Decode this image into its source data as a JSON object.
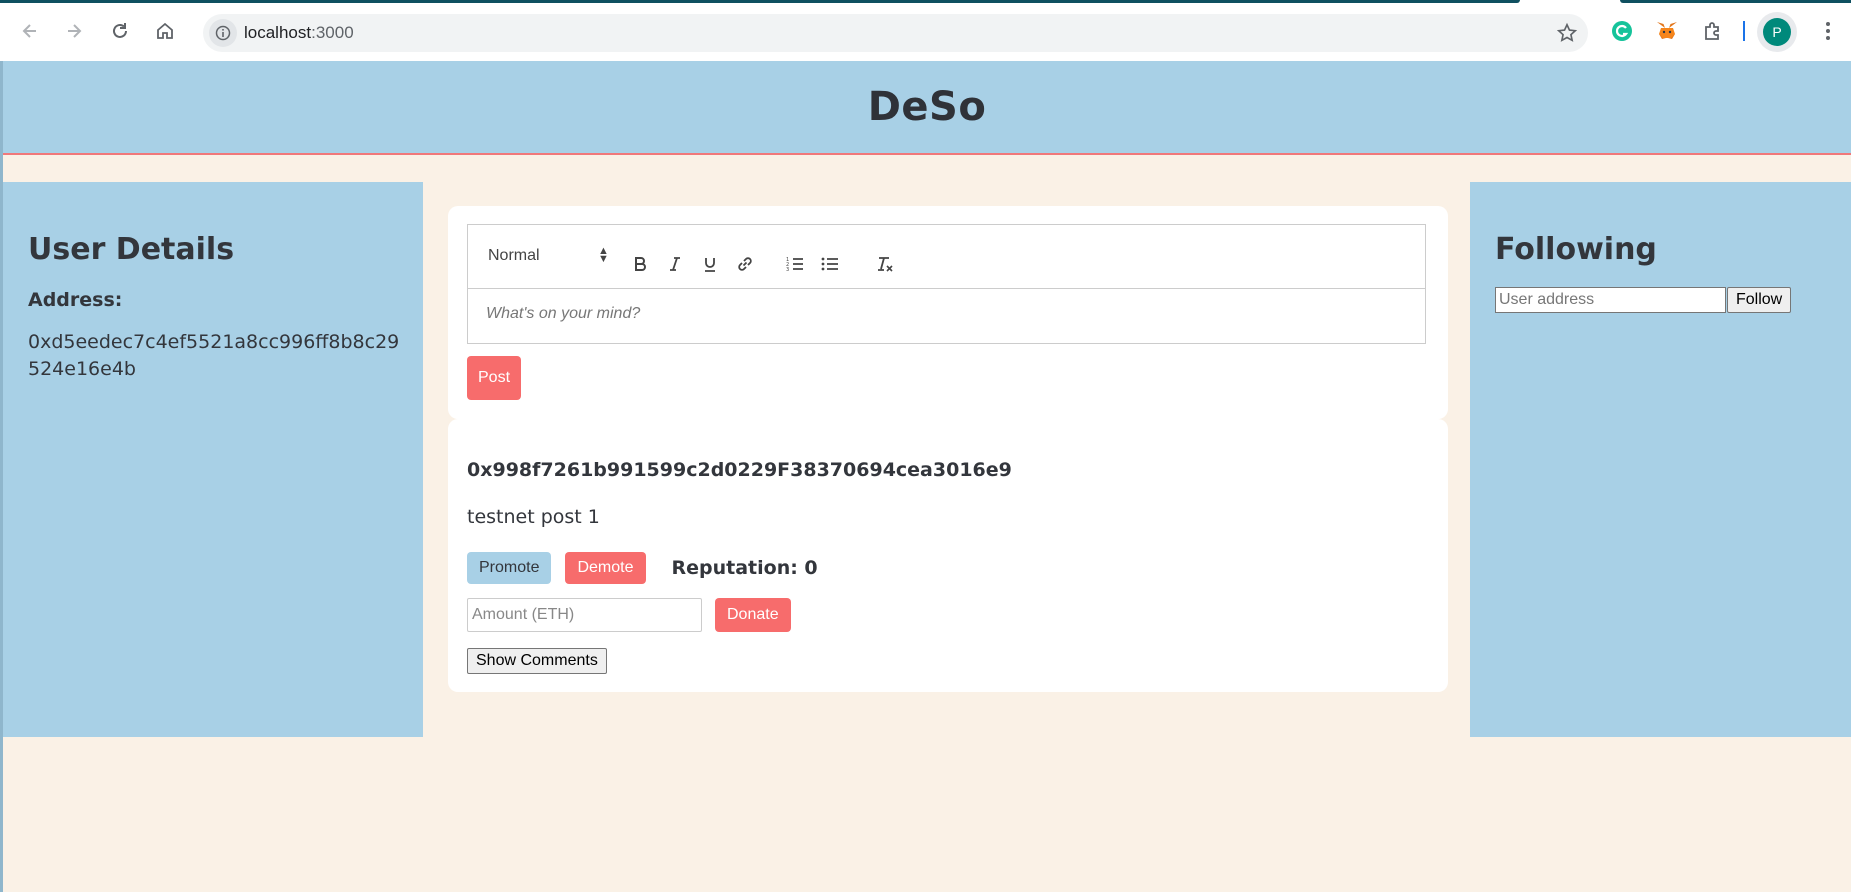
{
  "browser": {
    "url_host": "localhost",
    "url_port": ":3000",
    "profile_initial": "P"
  },
  "header": {
    "title": "DeSo"
  },
  "user_details": {
    "heading": "User Details",
    "address_label": "Address:",
    "address_value": "0xd5eedec7c4ef5521a8cc996ff8b8c29524e16e4b"
  },
  "composer": {
    "format_select": "Normal",
    "placeholder": "What's on your mind?",
    "post_label": "Post"
  },
  "post": {
    "author": "0x998f7261b991599c2d0229F38370694cea3016e9",
    "content": "testnet post 1",
    "promote_label": "Promote",
    "demote_label": "Demote",
    "reputation_text": "Reputation: 0",
    "amount_placeholder": "Amount (ETH)",
    "donate_label": "Donate",
    "show_comments_label": "Show Comments"
  },
  "following": {
    "heading": "Following",
    "input_placeholder": "User address",
    "follow_label": "Follow"
  },
  "colors": {
    "panel_blue": "#a8d0e6",
    "accent_red": "#f76c6c",
    "page_bg": "#faf1e6"
  }
}
